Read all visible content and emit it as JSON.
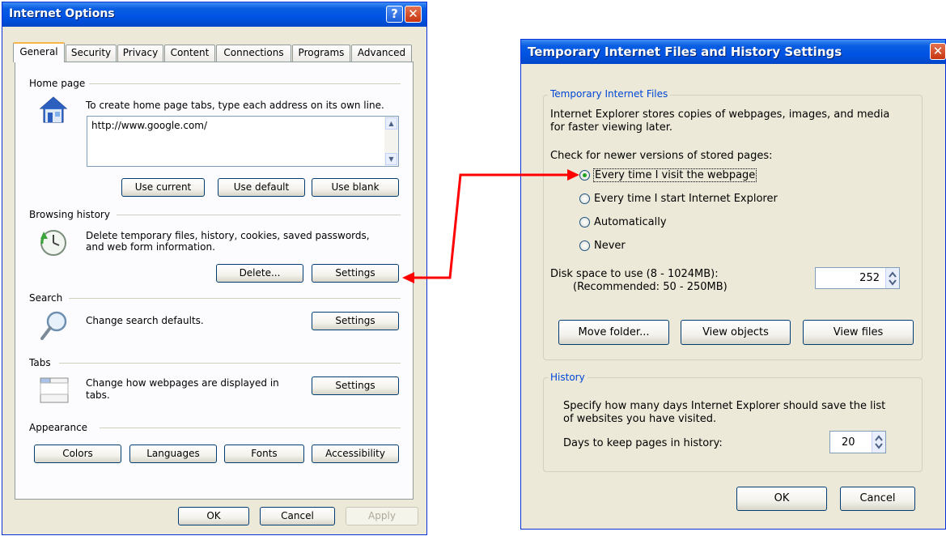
{
  "internet_options": {
    "title": "Internet Options",
    "tabs": [
      "General",
      "Security",
      "Privacy",
      "Content",
      "Connections",
      "Programs",
      "Advanced"
    ],
    "home_page": {
      "section": "Home page",
      "description": "To create home page tabs, type each address on its own line.",
      "url": "http://www.google.com/",
      "buttons": {
        "use_current": "Use current",
        "use_default": "Use default",
        "use_blank": "Use blank"
      }
    },
    "browsing_history": {
      "section": "Browsing history",
      "description_line1": "Delete temporary files, history, cookies, saved passwords,",
      "description_line2": "and web form information.",
      "delete": "Delete...",
      "settings": "Settings"
    },
    "search": {
      "section": "Search",
      "description": "Change search defaults.",
      "settings": "Settings"
    },
    "tabs_section": {
      "section": "Tabs",
      "description_line1": "Change how webpages are displayed in",
      "description_line2": "tabs.",
      "settings": "Settings"
    },
    "appearance": {
      "section": "Appearance",
      "colors": "Colors",
      "languages": "Languages",
      "fonts": "Fonts",
      "accessibility": "Accessibility"
    },
    "footer": {
      "ok": "OK",
      "cancel": "Cancel",
      "apply": "Apply"
    }
  },
  "tif_settings": {
    "title": "Temporary Internet Files and History Settings",
    "tif_group": {
      "title": "Temporary Internet Files",
      "description_line1": "Internet Explorer stores copies of webpages, images, and media",
      "description_line2": "for faster viewing later.",
      "check_label": "Check for newer versions of stored pages:",
      "options": [
        "Every time I visit the webpage",
        "Every time I start Internet Explorer",
        "Automatically",
        "Never"
      ],
      "selected_index": 0,
      "disk_space_line1": "Disk space to use (8 - 1024MB):",
      "disk_space_line2": "(Recommended: 50 - 250MB)",
      "disk_space_value": "252",
      "buttons": {
        "move_folder": "Move folder...",
        "view_objects": "View objects",
        "view_files": "View files"
      }
    },
    "history_group": {
      "title": "History",
      "description_line1": "Specify how many days Internet Explorer should save the list",
      "description_line2": "of websites you have visited.",
      "days_label": "Days to keep pages in history:",
      "days_value": "20"
    },
    "footer": {
      "ok": "OK",
      "cancel": "Cancel"
    }
  },
  "colors": {
    "title_bar": "#0054e3",
    "window_bg": "#ece9d8",
    "arrow": "#ff0000",
    "group_title": "#0046d5"
  }
}
